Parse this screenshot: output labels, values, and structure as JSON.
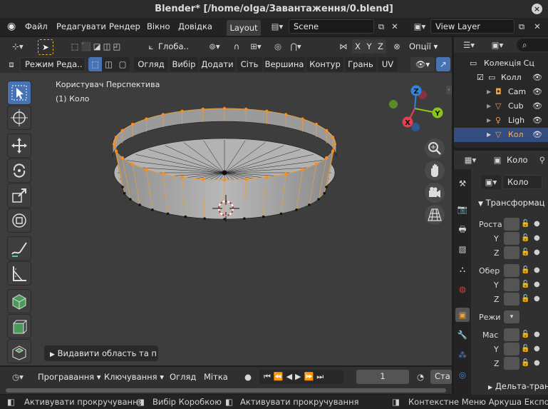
{
  "window": {
    "title": "Blender* [/home/olga/Завантаження/0.blend]"
  },
  "menubar": {
    "items": [
      "Файл",
      "Редагувати",
      "Рендер",
      "Вікно",
      "Довідка"
    ],
    "workspace_tab": "Layout",
    "scene": "Scene",
    "view_layer": "View Layer"
  },
  "header": {
    "orientation": "Глоба..",
    "axes": [
      "X",
      "Y",
      "Z"
    ],
    "options": "Опції",
    "mode": "Режим Реда..",
    "menus": [
      "Огляд",
      "Вибір",
      "Додати",
      "Сіть",
      "Вершина",
      "Контур",
      "Грань",
      "UV"
    ]
  },
  "viewport": {
    "view_name": "Користувач Перспектива",
    "object_name": "(1) Коло",
    "operator_panel": "Видавити область та п",
    "axis_labels": [
      "Z",
      "Y",
      "X"
    ],
    "colors": {
      "background": "#3d3d3d",
      "mesh_face": "#b7b7b7",
      "selected_vertex": "#ff8c1a",
      "x_axis": "#e83e52",
      "y_axis": "#8cc41c",
      "z_axis": "#2f84e0"
    }
  },
  "timeline": {
    "menus": [
      "Програвання",
      "Ключування",
      "Огляд",
      "Мітка"
    ],
    "frame": "1",
    "start_label": "Ста"
  },
  "status": {
    "hints": [
      "Активувати прокручування",
      "Вибір Коробкою",
      "Активувати прокручування",
      "Контекстне Меню Аркуша Експозиції"
    ]
  },
  "outliner": {
    "collection": "Колекція Сц",
    "items": [
      "Колл",
      "Cam",
      "Cub",
      "Ligh",
      "Кол"
    ]
  },
  "properties": {
    "object_tab": "Коло",
    "object_name": "Коло",
    "transform_section": "Трансформац",
    "location_label": "Роста",
    "rotation_label": "Обер",
    "mode_label": "Режи",
    "scale_label": "Мас",
    "axis_y": "Y",
    "axis_z": "Z",
    "delta_section": "Дельта-тран"
  }
}
